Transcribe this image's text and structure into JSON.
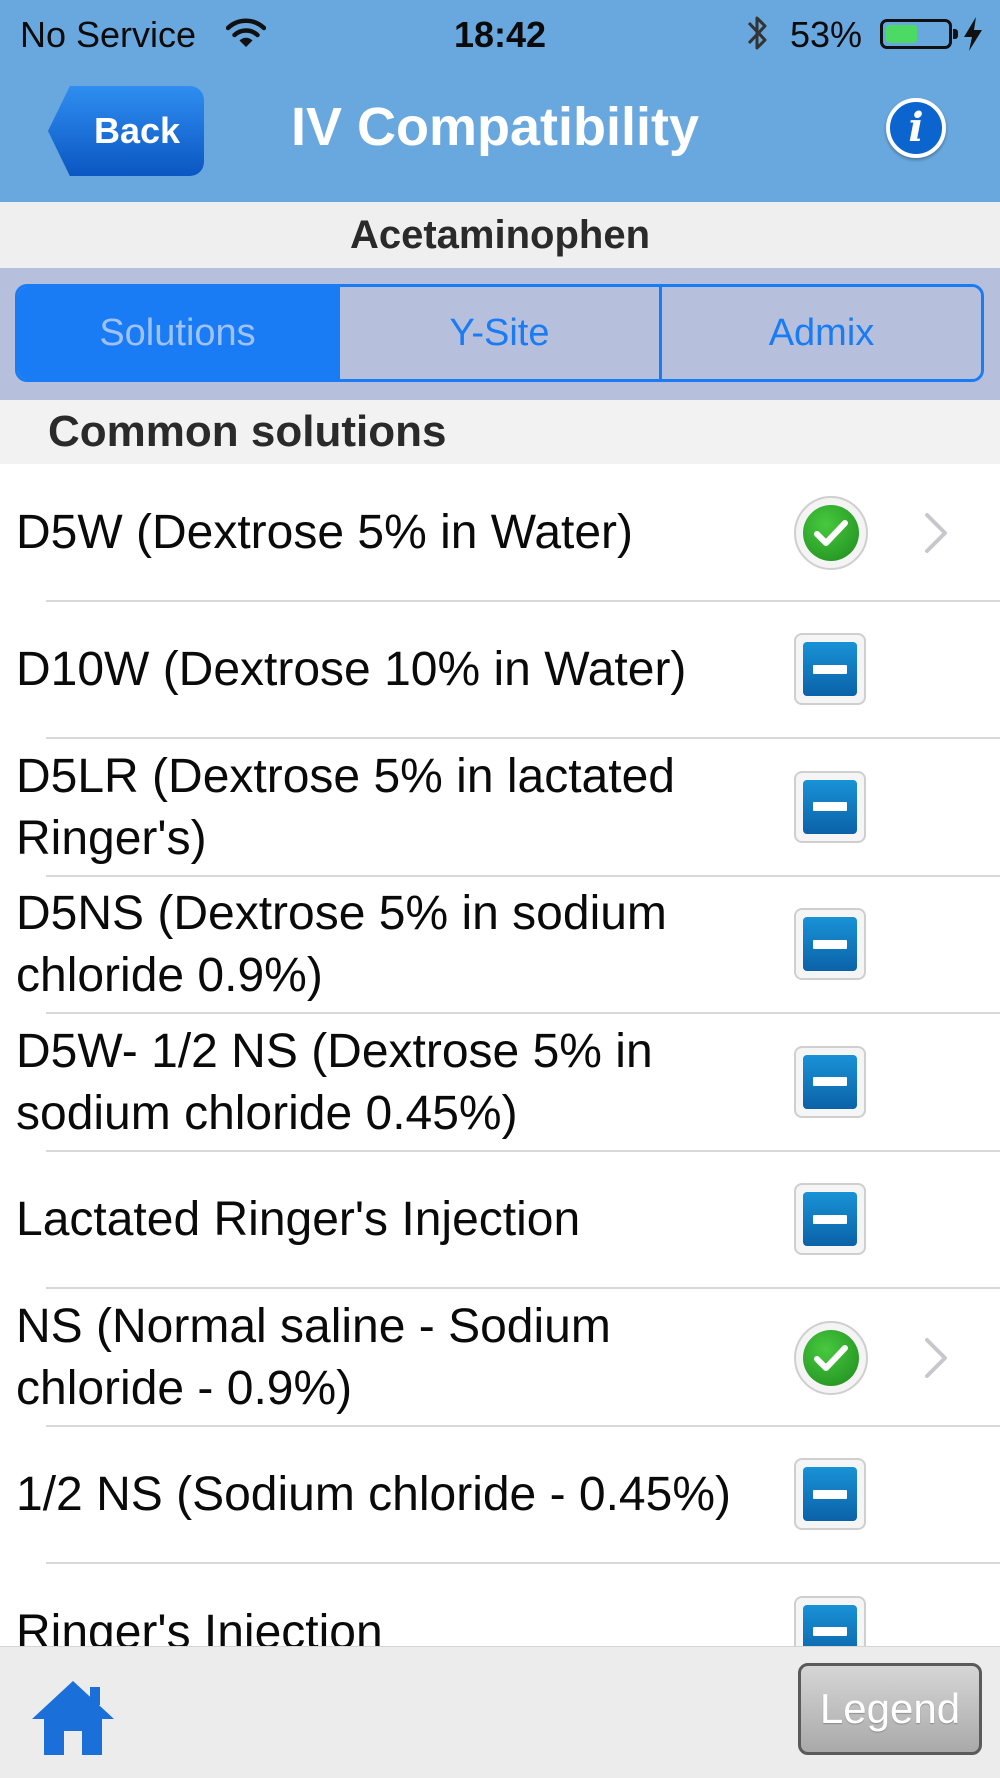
{
  "status_bar": {
    "carrier": "No Service",
    "time": "18:42",
    "battery_percent": "53%",
    "battery_level": 0.53
  },
  "nav": {
    "back_label": "Back",
    "title": "IV Compatibility",
    "info_icon": "info-icon",
    "info_glyph": "i"
  },
  "drug_name": "Acetaminophen",
  "segments": [
    {
      "label": "Solutions",
      "selected": true
    },
    {
      "label": "Y-Site",
      "selected": false
    },
    {
      "label": "Admix",
      "selected": false
    }
  ],
  "section_header": "Common solutions",
  "solutions": [
    {
      "label": "D5W (Dextrose 5% in Water)",
      "status": "compatible",
      "has_detail": true
    },
    {
      "label": "D10W (Dextrose 10% in Water)",
      "status": "no-data",
      "has_detail": false
    },
    {
      "label": "D5LR (Dextrose 5% in lactated Ringer's)",
      "status": "no-data",
      "has_detail": false
    },
    {
      "label": "D5NS (Dextrose 5% in sodium chloride 0.9%)",
      "status": "no-data",
      "has_detail": false
    },
    {
      "label": "D5W- 1/2 NS (Dextrose 5% in sodium chloride 0.45%)",
      "status": "no-data",
      "has_detail": false
    },
    {
      "label": "Lactated Ringer's Injection",
      "status": "no-data",
      "has_detail": false
    },
    {
      "label": "NS (Normal saline - Sodium chloride - 0.9%)",
      "status": "compatible",
      "has_detail": true
    },
    {
      "label": "1/2 NS (Sodium chloride - 0.45%)",
      "status": "no-data",
      "has_detail": false
    },
    {
      "label": "Ringer's Injection",
      "status": "no-data",
      "has_detail": false
    }
  ],
  "toolbar": {
    "home_icon": "home-icon",
    "legend_label": "Legend"
  },
  "colors": {
    "nav_background": "#69a8de",
    "segment_accent": "#1a7cf5",
    "compatible_green": "#2ea82a",
    "no_data_blue": "#1178c2"
  }
}
